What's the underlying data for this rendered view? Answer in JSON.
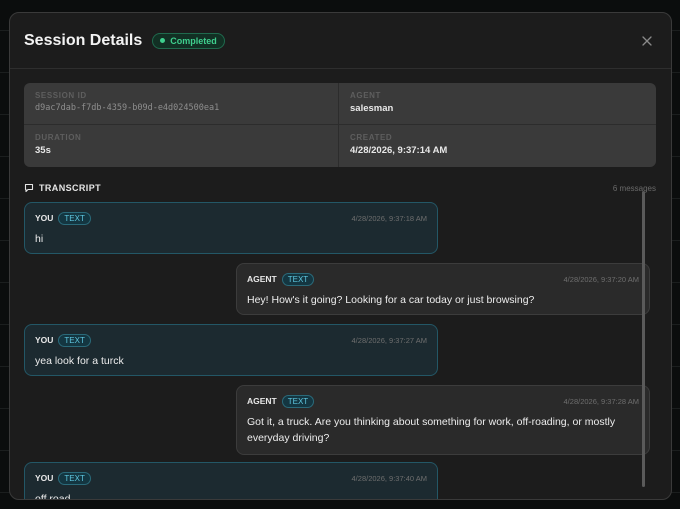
{
  "modal": {
    "title": "Session Details",
    "status": "Completed",
    "close_label": "×"
  },
  "info": {
    "session_id_label": "SESSION ID",
    "session_id": "d9ac7dab-f7db-4359-b09d-e4d024500ea1",
    "agent_label": "AGENT",
    "agent": "salesman",
    "duration_label": "DURATION",
    "duration": "35s",
    "created_label": "CREATED",
    "created": "4/28/2026, 9:37:14 AM"
  },
  "transcript": {
    "title": "TRANSCRIPT",
    "count": "6 messages",
    "messages": [
      {
        "role": "YOU",
        "type": "TEXT",
        "time": "4/28/2026, 9:37:18 AM",
        "text": "hi"
      },
      {
        "role": "AGENT",
        "type": "TEXT",
        "time": "4/28/2026, 9:37:20 AM",
        "text": "Hey! How's it going? Looking for a car today or just browsing?"
      },
      {
        "role": "YOU",
        "type": "TEXT",
        "time": "4/28/2026, 9:37:27 AM",
        "text": "yea look for a turck"
      },
      {
        "role": "AGENT",
        "type": "TEXT",
        "time": "4/28/2026, 9:37:28 AM",
        "text": "Got it, a truck. Are you thinking about something for work, off-roading, or mostly everyday driving?"
      },
      {
        "role": "YOU",
        "type": "TEXT",
        "time": "4/28/2026, 9:37:40 AM",
        "text": "off road"
      }
    ]
  },
  "colors": {
    "accent_green": "#3fcf8e",
    "accent_cyan": "#5fc6df",
    "modal_bg": "#1c1c1c"
  }
}
